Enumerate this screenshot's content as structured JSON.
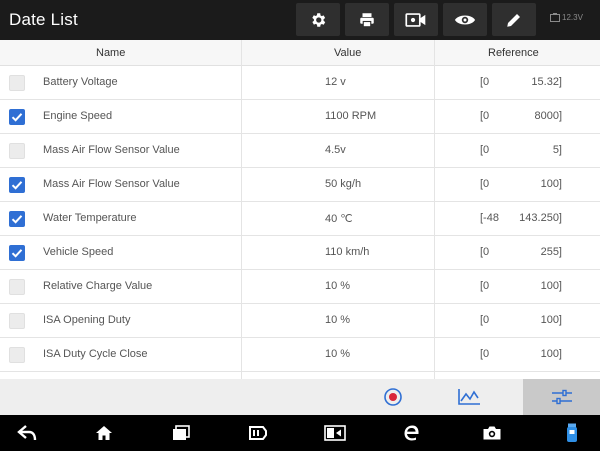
{
  "header": {
    "title": "Date List",
    "battery_text": "12.3V",
    "toolbar_icons": [
      "gear-icon",
      "printer-icon",
      "video-camera-icon",
      "eye-icon",
      "pencil-icon"
    ]
  },
  "table": {
    "columns": {
      "name": "Name",
      "value": "Value",
      "reference": "Reference"
    },
    "rows": [
      {
        "checked": false,
        "name": "Battery Voltage",
        "value": "12 v",
        "ref_low": "[0",
        "ref_high": "15.32]"
      },
      {
        "checked": true,
        "name": "Engine Speed",
        "value": "1100 RPM",
        "ref_low": "[0",
        "ref_high": "8000]"
      },
      {
        "checked": false,
        "name": "Mass Air Flow Sensor Value",
        "value": "4.5v",
        "ref_low": "[0",
        "ref_high": "5]"
      },
      {
        "checked": true,
        "name": "Mass Air Flow Sensor Value",
        "value": "50 kg/h",
        "ref_low": "[0",
        "ref_high": "100]"
      },
      {
        "checked": true,
        "name": "Water Temperature",
        "value": "40 ℃",
        "ref_low": "[-48",
        "ref_high": "143.250]"
      },
      {
        "checked": true,
        "name": "Vehicle Speed",
        "value": "110 km/h",
        "ref_low": "[0",
        "ref_high": "255]"
      },
      {
        "checked": false,
        "name": "Relative Charge Value",
        "value": "10  %",
        "ref_low": "[0",
        "ref_high": "100]"
      },
      {
        "checked": false,
        "name": "ISA Opening Duty",
        "value": "10  %",
        "ref_low": "[0",
        "ref_high": "100]"
      },
      {
        "checked": false,
        "name": "ISA Duty Cycle Close",
        "value": "10  %",
        "ref_low": "[0",
        "ref_high": "100]"
      }
    ]
  },
  "actions": {
    "icons": [
      "record-icon",
      "graph-icon",
      "settings-sliders-icon"
    ],
    "active": "settings-sliders-icon",
    "accent_color": "#2f6fd4",
    "record_color": "#d9263b"
  },
  "navbar": {
    "icons": [
      "back-icon",
      "home-icon",
      "recent-apps-icon",
      "vci-icon",
      "screen-mirror-icon",
      "browser-icon",
      "screenshot-icon",
      "vci-connection-icon"
    ]
  }
}
